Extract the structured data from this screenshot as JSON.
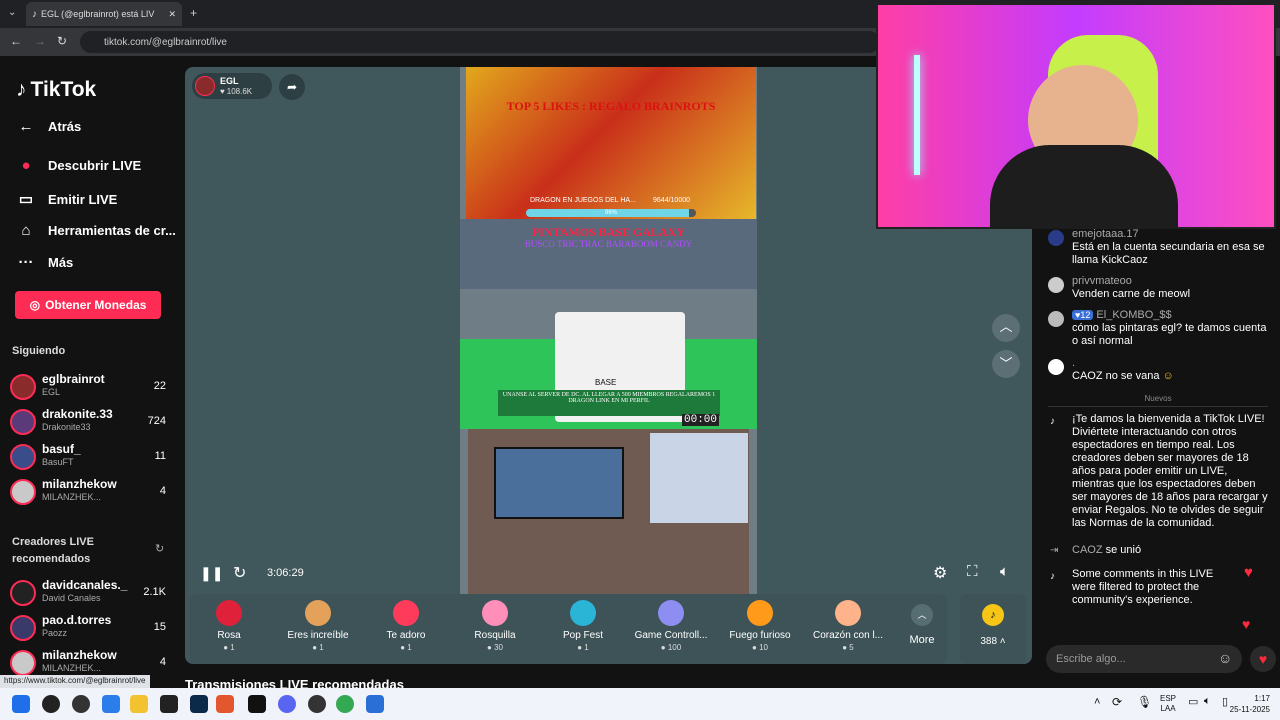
{
  "browser": {
    "tab_title": "EGL (@eglbrainrot) está LIV",
    "url": "tiktok.com/@eglbrainrot/live",
    "status_url": "https://www.tiktok.com/@eglbrainrot/live"
  },
  "sidebar": {
    "logo": "TikTok",
    "back": "Atrás",
    "nav": [
      "Descubrir LIVE",
      "Emitir LIVE",
      "Herramientas de cr...",
      "Más"
    ],
    "coins_button": "Obtener Monedas",
    "following_title": "Siguiendo",
    "following": [
      {
        "name": "eglbrainrot",
        "sub": "EGL",
        "count": "22"
      },
      {
        "name": "drakonite.33",
        "sub": "Drakonite33",
        "count": "724"
      },
      {
        "name": "basuf_",
        "sub": "BasuFT",
        "count": "11"
      },
      {
        "name": "milanzhekow",
        "sub": "MILANZHEK...",
        "count": "4"
      }
    ],
    "recommended_title": "Creadores LIVE recomendados",
    "recommended": [
      {
        "name": "davidcanales._",
        "sub": "David Canales",
        "count": "2.1K"
      },
      {
        "name": "pao.d.torres",
        "sub": "Paozz",
        "count": "15"
      },
      {
        "name": "milanzhekow",
        "sub": "MILANZHEK...",
        "count": "4"
      }
    ]
  },
  "stream": {
    "host": "EGL",
    "likes": "108.6K",
    "banner_title": "TOP 5 LIKES : REGALO BRAINROTS",
    "goal_text": "DRAGON EN JUEGOS DEL HA...",
    "goal_count": "9644/10000",
    "goal_percent": "96%",
    "goal_progress": 0.96,
    "overlay_title": "PINTAMOS BASE GALAXY",
    "overlay_sub": "BUSCO TRIC TRAC BARABOOM CANDY",
    "server_text": "UNANSE AL SERVER DE DC. AL LLEGAR A 500 MIEMBROS REGALAREMOS 1 DRAGON LINK EN MI PERFIL",
    "timer": "00:00",
    "base_label": "BASE",
    "elapsed": "3:06:29"
  },
  "gifts": [
    {
      "name": "Rosa",
      "price": "1",
      "color": "#e0213a"
    },
    {
      "name": "Eres increíble",
      "price": "1",
      "color": "#e3a15a"
    },
    {
      "name": "Te adoro",
      "price": "1",
      "color": "#ff3b5c"
    },
    {
      "name": "Rosquilla",
      "price": "30",
      "color": "#ff8fb8"
    },
    {
      "name": "Pop Fest",
      "price": "1",
      "color": "#2ab5d6"
    },
    {
      "name": "Game Controll...",
      "price": "100",
      "color": "#8e8ef2"
    },
    {
      "name": "Fuego furioso",
      "price": "10",
      "color": "#ff9a1a"
    },
    {
      "name": "Corazón con l...",
      "price": "5",
      "color": "#ffb38a"
    }
  ],
  "gifts_more": "More",
  "coins": "388",
  "chat": [
    {
      "user": "emejotaaa.17",
      "text": "Está en la cuenta secundaria en esa se llama KickCaoz"
    },
    {
      "user": "privvmateoo",
      "text": "Venden carne de meowl"
    },
    {
      "user": "El_KOMBO_$$",
      "badge": "12",
      "text": "cómo las pintaras egl? te damos cuenta o así normal"
    },
    {
      "user": ".",
      "text": "CAOZ no se vana"
    }
  ],
  "chat_divider": "Nuevos",
  "welcome": "¡Te damos la bienvenida a TikTok LIVE! Diviértete interactuando con otros espectadores en tiempo real. Los creadores deben ser mayores de 18 años para poder emitir un LIVE, mientras que los espectadores deben ser mayores de 18 años para recargar y enviar Regalos. No te olvides de seguir las Normas de la comunidad.",
  "joined_user": "CAOZ",
  "joined_text": "se unió",
  "filtered": "Some comments in this LIVE were filtered to protect the community's experience.",
  "chat_input_placeholder": "Escribe algo...",
  "below_title": "Transmisiones LIVE recomendadas",
  "taskbar": {
    "lang1": "ESP",
    "lang2": "LAA",
    "time": "1:17",
    "date": "25-11-2025"
  }
}
